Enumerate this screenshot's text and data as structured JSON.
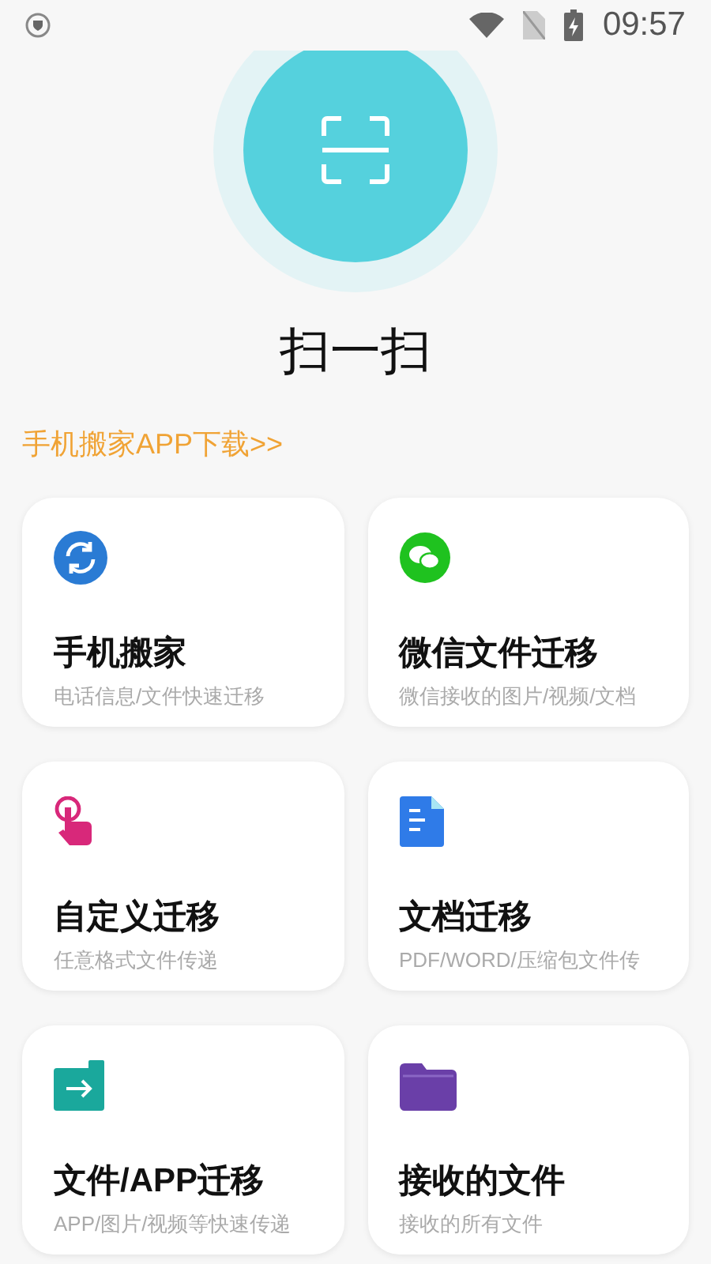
{
  "status_bar": {
    "time": "09:57"
  },
  "scan": {
    "title": "扫一扫"
  },
  "download_link": "手机搬家APP下载>>",
  "cards": [
    {
      "kind": "phone-move",
      "title": "手机搬家",
      "subtitle": "电话信息/文件快速迁移",
      "color": "#2a7bd4"
    },
    {
      "kind": "wechat",
      "title": "微信文件迁移",
      "subtitle": "微信接收的图片/视频/文档",
      "color": "#1fc21f"
    },
    {
      "kind": "custom",
      "title": "自定义迁移",
      "subtitle": "任意格式文件传递",
      "color": "#d8287a"
    },
    {
      "kind": "document",
      "title": "文档迁移",
      "subtitle": "PDF/WORD/压缩包文件传",
      "color": "#2f7be8"
    },
    {
      "kind": "app",
      "title": "文件/APP迁移",
      "subtitle": "APP/图片/视频等快速传递",
      "color": "#1aa89c"
    },
    {
      "kind": "received",
      "title": "接收的文件",
      "subtitle": "接收的所有文件",
      "color": "#6a3fa8"
    }
  ]
}
